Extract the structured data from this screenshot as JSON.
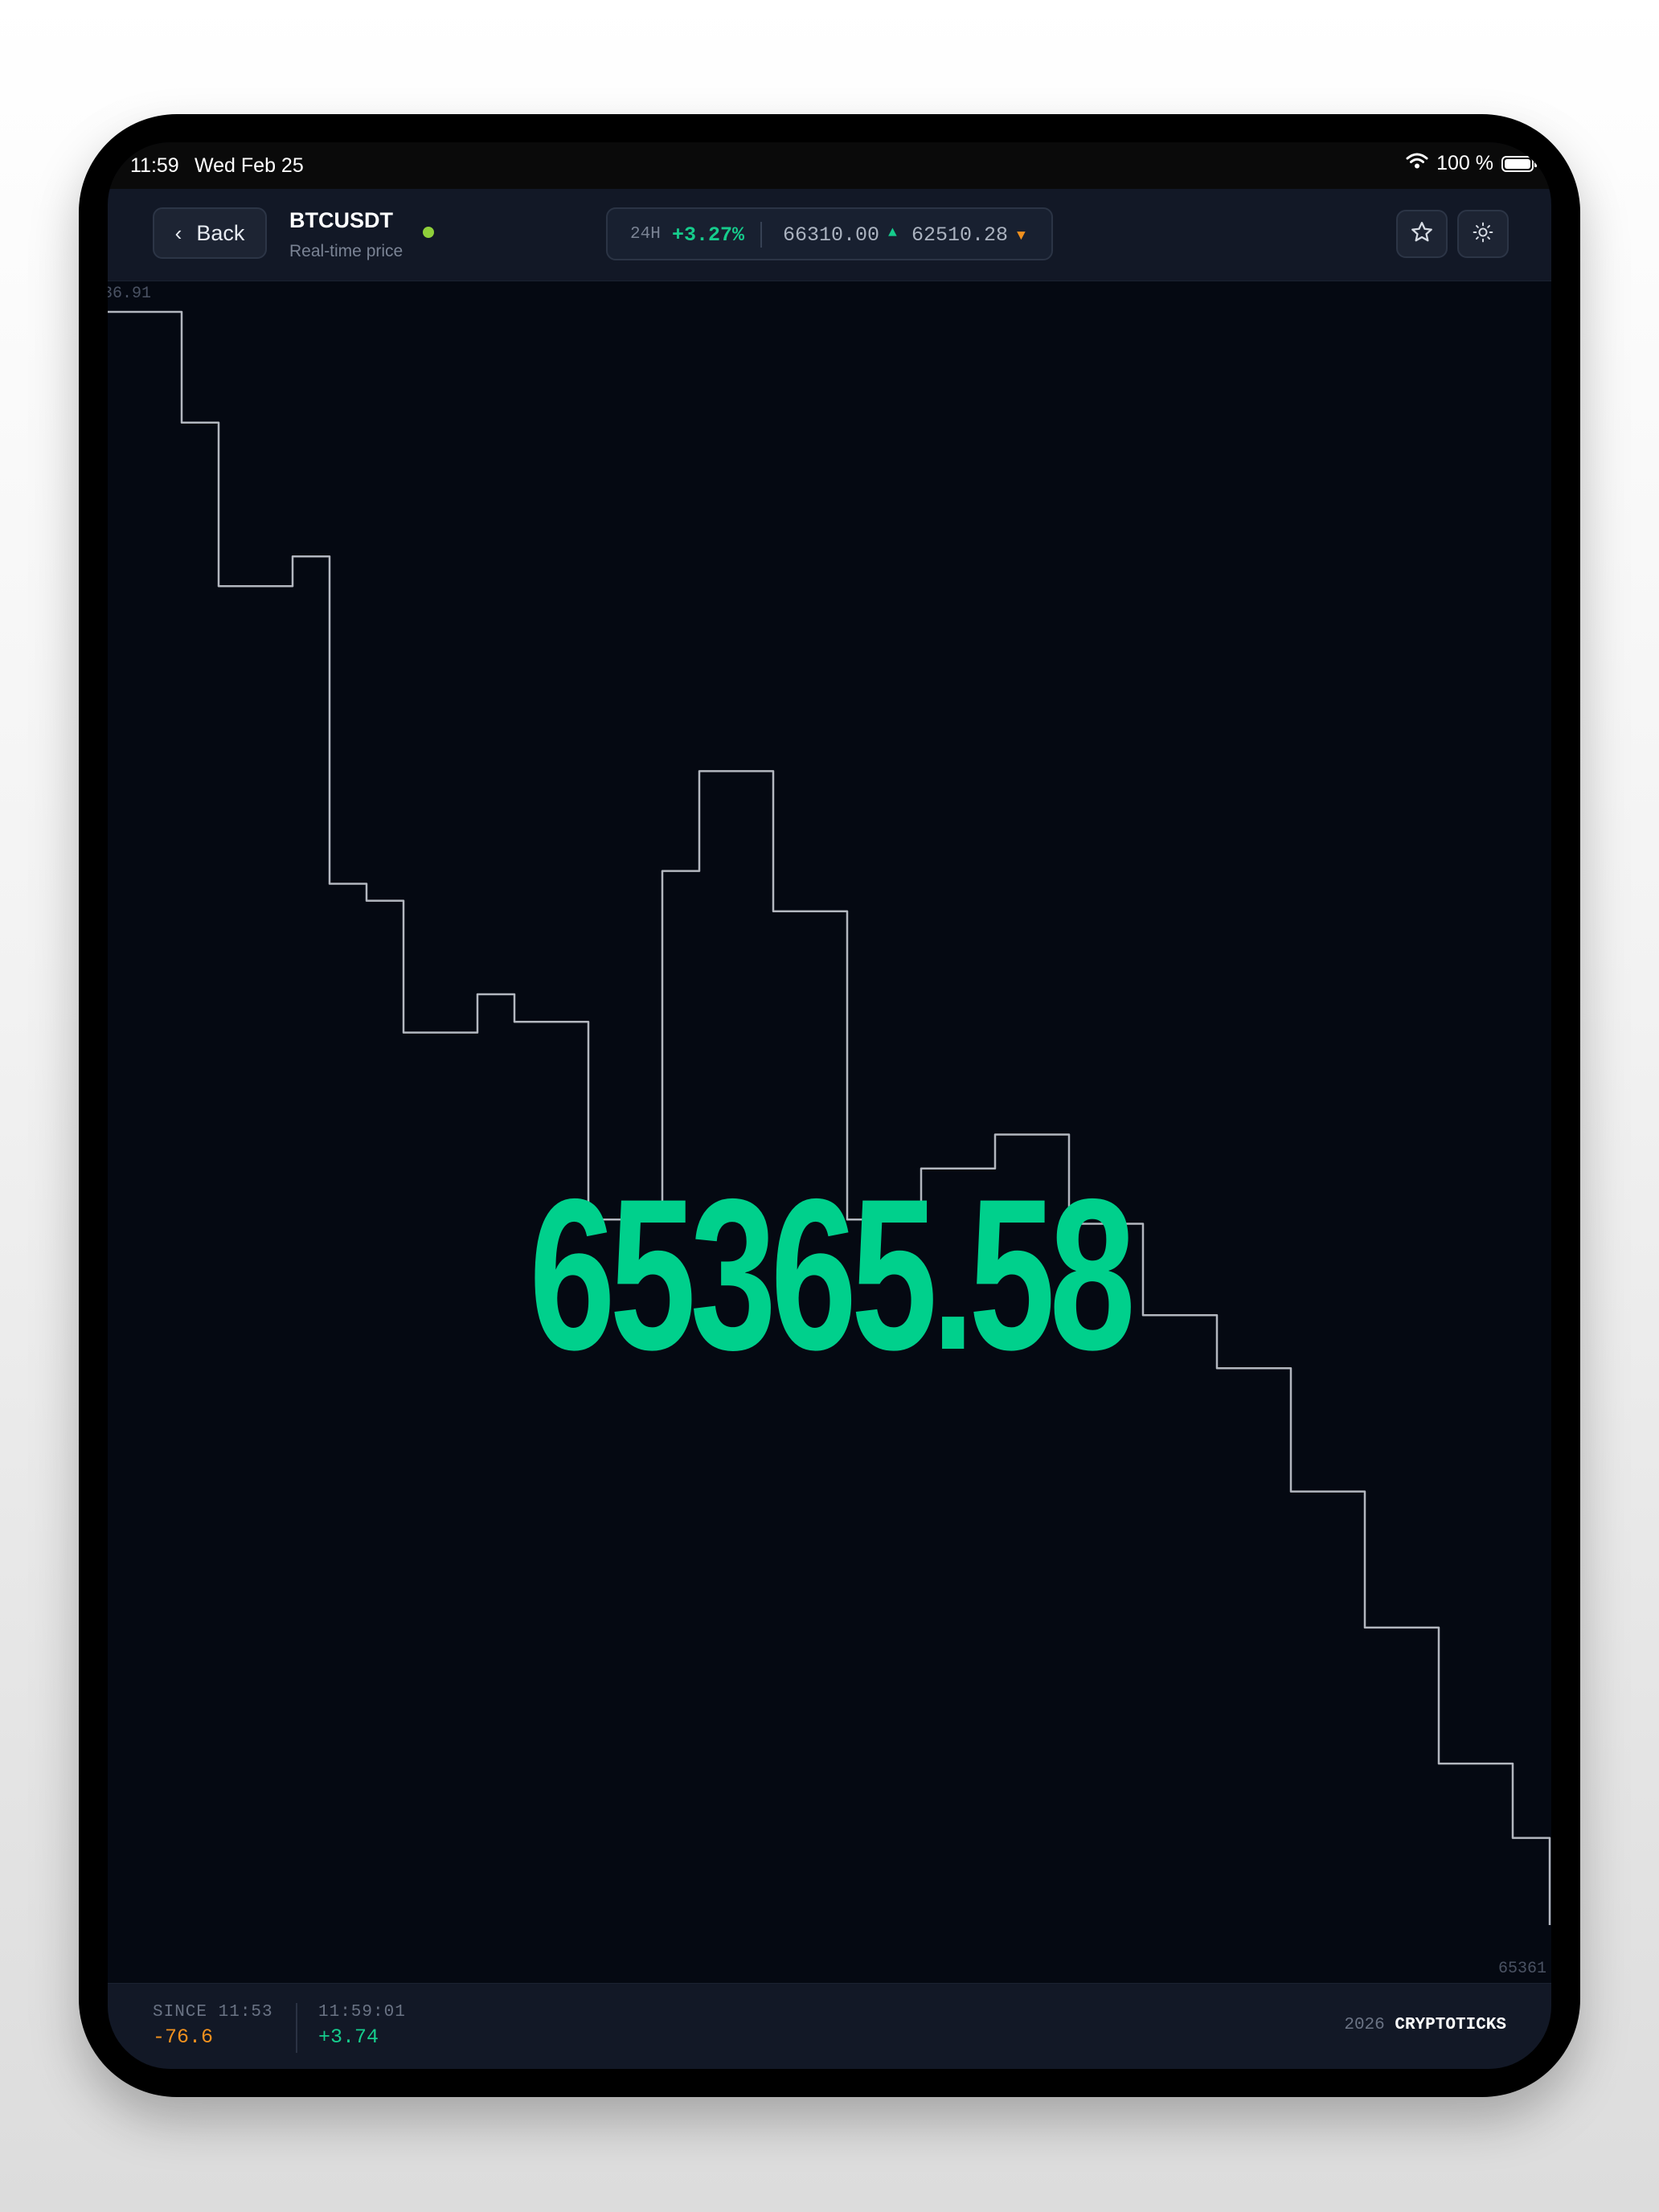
{
  "status_bar": {
    "time": "11:59",
    "date": "Wed Feb 25",
    "battery": "100 %"
  },
  "header": {
    "back_label": "Back",
    "symbol": "BTCUSDT",
    "subtitle": "Real-time price",
    "live_color": "#8fcf3a",
    "stats": {
      "period": "24H",
      "change": "+3.27%",
      "high": "66310.00",
      "low": "62510.28",
      "up_color": "#16cc8c",
      "down_color": "#f0901e"
    },
    "icons": [
      "star-icon",
      "sun-icon"
    ]
  },
  "chart": {
    "axis_top_label": "36.91",
    "axis_bottom_label": "65361",
    "price": "65365.58",
    "price_color": "#00d08c",
    "line_color": "#b3b7bf"
  },
  "footer": {
    "since_label": "SINCE 11:53",
    "since_value": "-76.6",
    "tick_label": "11:59:01",
    "tick_value": "+3.74",
    "brand_year": "2026",
    "brand_name": "CRYPTOTICKS"
  },
  "chart_data": {
    "type": "line",
    "title": "",
    "xlabel": "",
    "ylabel": "",
    "ylim": [
      65361,
      65436.91
    ],
    "grid": false,
    "values": [
      65436.91,
      65436.91,
      65431.7,
      65424.0,
      65424.0,
      65425.4,
      65410.0,
      65409.2,
      65403.0,
      65403.0,
      65404.8,
      65403.5,
      65403.5,
      65394.2,
      65394.2,
      65410.6,
      65415.3,
      65415.3,
      65408.7,
      65408.7,
      65394.2,
      65394.2,
      65396.6,
      65396.6,
      65398.2,
      65398.2,
      65394.0,
      65394.0,
      65389.7,
      65389.7,
      65387.2,
      65387.2,
      65381.4,
      65381.4,
      65375.0,
      65375.0,
      65368.6,
      65368.6,
      65365.1,
      65361.0
    ]
  }
}
